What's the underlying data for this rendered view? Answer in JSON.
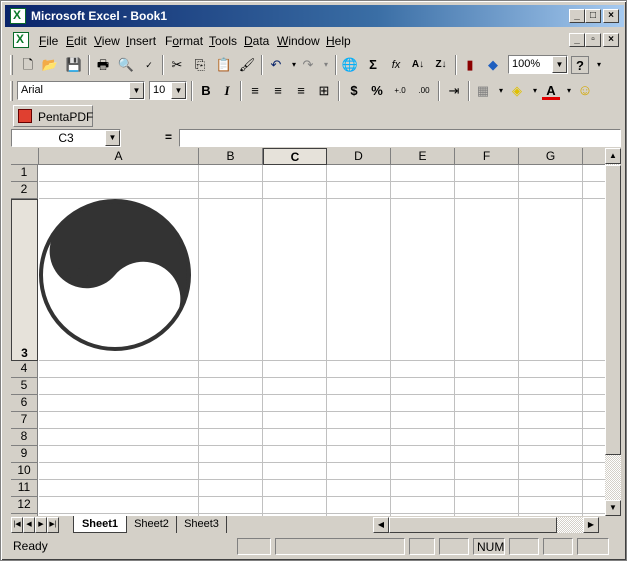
{
  "window": {
    "title": "Microsoft Excel - Book1"
  },
  "menu": [
    "File",
    "Edit",
    "View",
    "Insert",
    "Format",
    "Tools",
    "Data",
    "Window",
    "Help"
  ],
  "menu_underline": [
    "F",
    "E",
    "V",
    "I",
    "o",
    "T",
    "D",
    "W",
    "H"
  ],
  "toolbar": {
    "zoom": "100%",
    "help_glyph": "?"
  },
  "format": {
    "font": "Arial",
    "size": "10",
    "bold": "B",
    "italic": "I",
    "currency": "$",
    "percent": "%",
    "inc_dec": "+.0",
    "dec_dec": ".00",
    "font_color_glyph": "A"
  },
  "pentapdf": {
    "label": "PentaPDF"
  },
  "formula": {
    "name_box": "C3",
    "equals": "=",
    "value": ""
  },
  "columns": [
    "A",
    "B",
    "C",
    "D",
    "E",
    "F",
    "G"
  ],
  "rows": [
    "1",
    "2",
    "3",
    "4",
    "5",
    "6",
    "7",
    "8",
    "9",
    "10",
    "11",
    "12"
  ],
  "sheets": [
    "Sheet1",
    "Sheet2",
    "Sheet3"
  ],
  "status": {
    "text": "Ready",
    "num": "NUM"
  },
  "colors": {
    "title_start": "#0a246a",
    "title_end": "#a6caf0",
    "yinyang": "#333333"
  }
}
